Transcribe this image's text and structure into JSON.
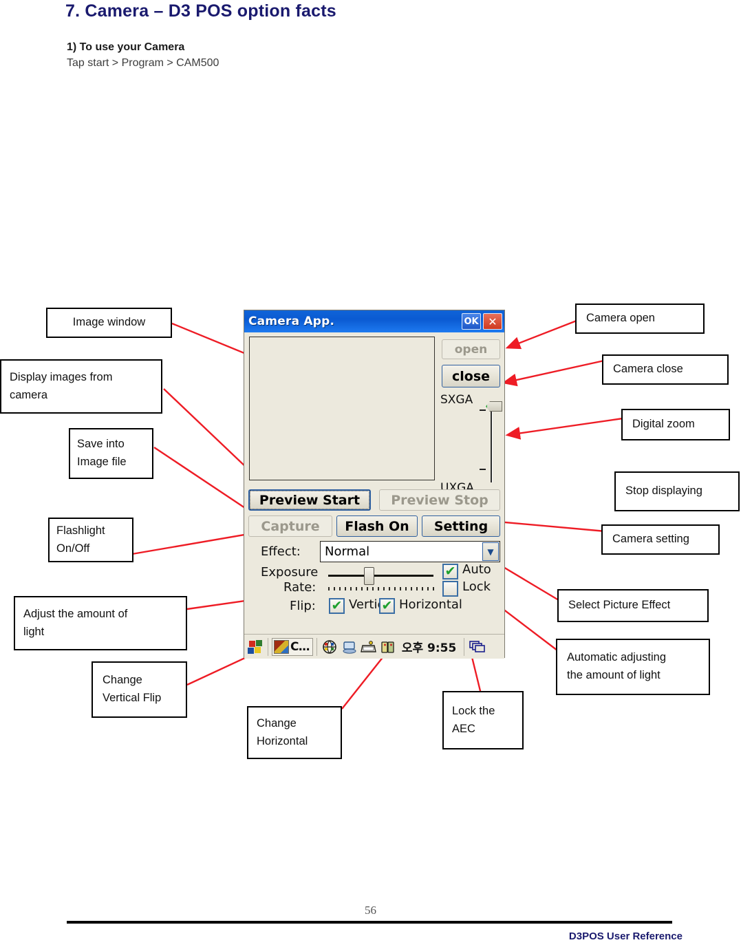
{
  "document": {
    "title": "7. Camera – D3 POS option facts",
    "section": "1) To use your Camera",
    "path": "Tap start > Program > CAM500",
    "page_number": "56",
    "footer": "D3POS User Reference"
  },
  "callouts": {
    "image_window": "Image window",
    "display_images": "Display images from camera",
    "save_into": "Save into Image file",
    "flashlight": "Flashlight On/Off",
    "adjust_light": "Adjust the amount of light",
    "change_vertical": "Change Vertical Flip",
    "change_horizontal": "Change Horizontal",
    "lock_aec": "Lock the AEC",
    "camera_open": "Camera open",
    "camera_close": "Camera close",
    "digital_zoom": "Digital zoom",
    "stop_displaying": "Stop displaying",
    "camera_setting": "Camera setting",
    "select_effect": "Select Picture Effect",
    "auto_adjust": "Automatic adjusting the amount of light"
  },
  "callout_lines": {
    "display_images_l1": "Display  images  from",
    "display_images_l2": "camera",
    "save_into_l1": "Save   into",
    "save_into_l2": "Image file",
    "flashlight_l1": "Flashlight",
    "flashlight_l2": "On/Off",
    "adjust_light_l1": "Adjust  the  amount  of",
    "adjust_light_l2": "light",
    "change_vertical_l1": "Change",
    "change_vertical_l2": "Vertical Flip",
    "change_horizontal_l1": "Change",
    "change_horizontal_l2": "Horizontal",
    "lock_aec_l1": "Lock   the",
    "lock_aec_l2": "AEC",
    "auto_adjust_l1": "Automatic  adjusting",
    "auto_adjust_l2": "the amount of light"
  },
  "camera_app": {
    "title": "Camera App.",
    "titlebar_buttons": {
      "ok": "OK",
      "close": "✕"
    },
    "buttons": {
      "open": "open",
      "close": "close",
      "preview_start": "Preview Start",
      "preview_stop": "Preview Stop",
      "capture": "Capture",
      "flash": "Flash On",
      "setting": "Setting"
    },
    "zoom": {
      "top_label": "SXGA",
      "bottom_label": "UXGA"
    },
    "effect": {
      "label": "Effect:",
      "value": "Normal",
      "arrow": "▼"
    },
    "exposure": {
      "label_line1": "Exposure",
      "label_line2": "Rate:"
    },
    "aec": {
      "auto": "Auto",
      "lock": "Lock",
      "auto_checked": "✔",
      "lock_checked": ""
    },
    "flip": {
      "label": "Flip:",
      "vertical": "Vertical",
      "horizontal": "Horizontal",
      "check": "✔"
    },
    "taskbar": {
      "task_label": "C...",
      "clock": "오후 9:55"
    }
  },
  "colors": {
    "heading": "#1a1a6e",
    "leader": "#ee1c25",
    "titlebar": "#0a5ad2",
    "window_bg": "#ece9dd",
    "check_green": "#1ea02e"
  }
}
